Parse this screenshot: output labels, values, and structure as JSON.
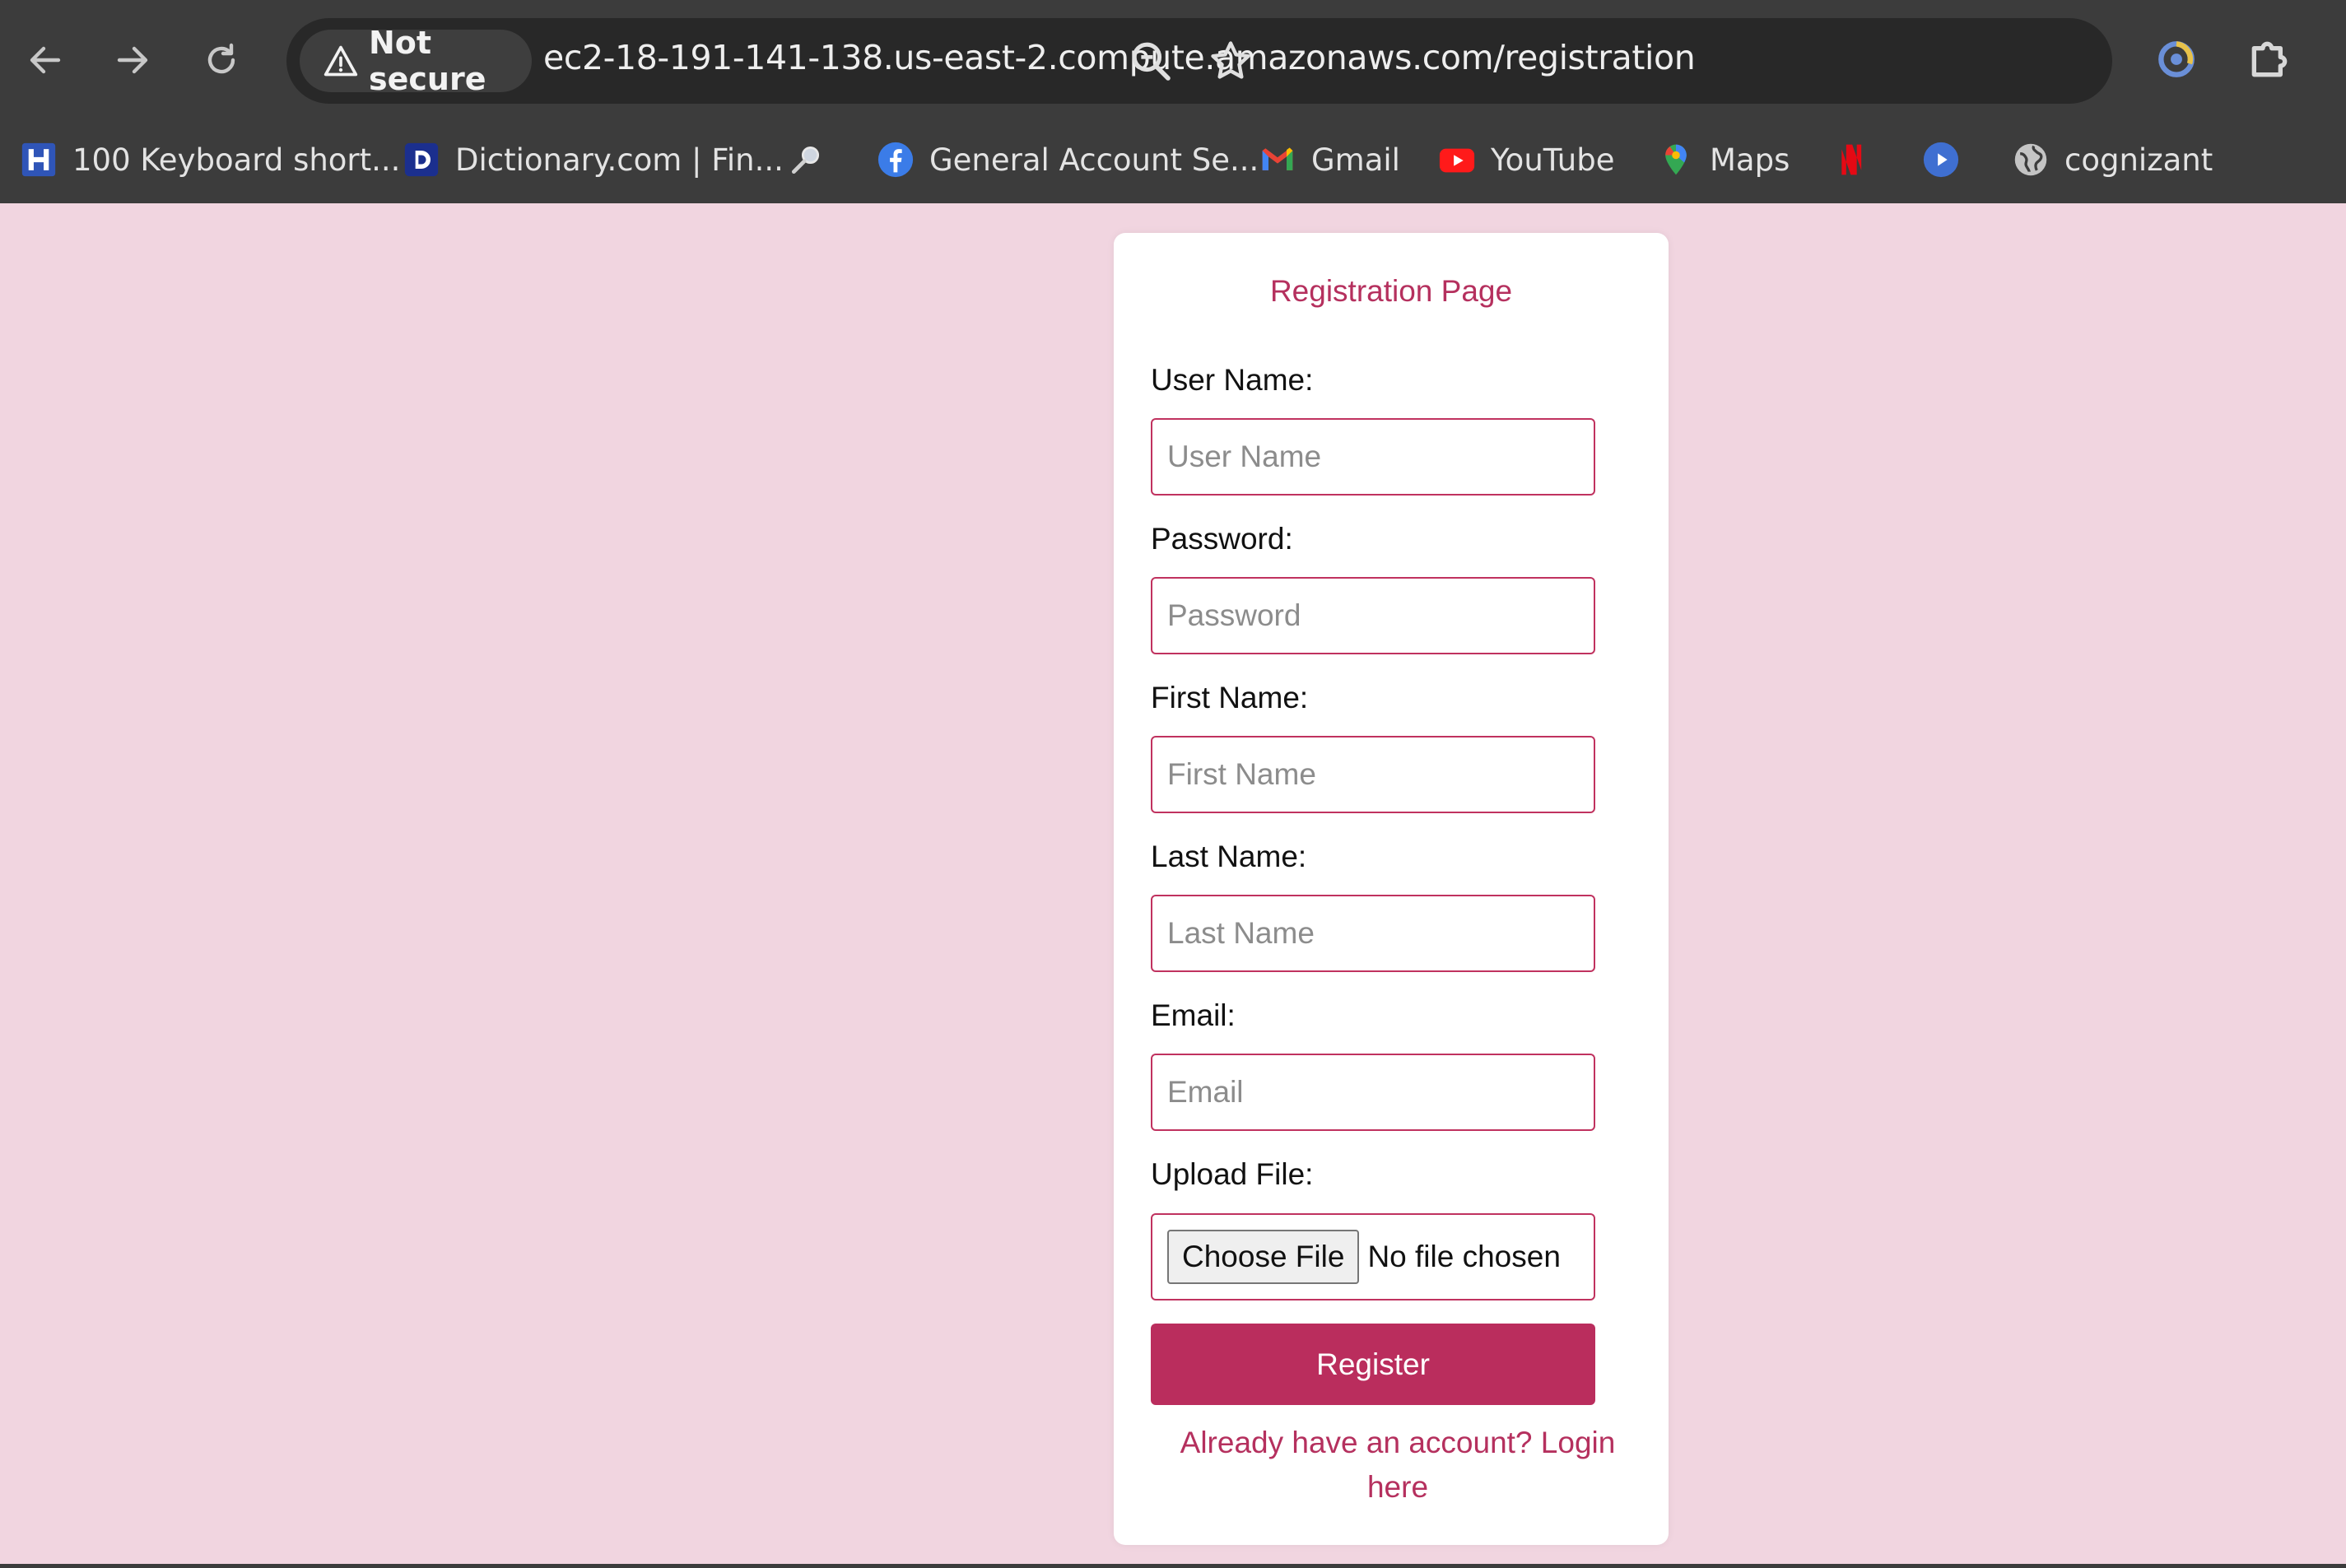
{
  "browser": {
    "security_label": "Not secure",
    "url": "ec2-18-191-141-138.us-east-2.compute.amazonaws.com/registration",
    "nav_icons": [
      "back-arrow-icon",
      "forward-arrow-icon",
      "reload-icon"
    ],
    "omnibox_icons": [
      "zoom-icon",
      "bookmark-star-icon"
    ],
    "toolbar_icons": [
      "extension-icon",
      "extensions-puzzle-icon"
    ],
    "bookmarks": [
      {
        "label": "100 Keyboard short...",
        "icon": "h-logo-icon"
      },
      {
        "label": "Dictionary.com | Fin...",
        "icon": "dictionary-logo-icon"
      },
      {
        "label": "",
        "icon": "magnifier-icon"
      },
      {
        "label": "General Account Se...",
        "icon": "facebook-icon"
      },
      {
        "label": "Gmail",
        "icon": "gmail-icon"
      },
      {
        "label": "YouTube",
        "icon": "youtube-icon"
      },
      {
        "label": "Maps",
        "icon": "maps-pin-icon"
      },
      {
        "label": "",
        "icon": "netflix-icon"
      },
      {
        "label": "",
        "icon": "play-circle-icon"
      },
      {
        "label": "cognizant",
        "icon": "globe-icon"
      }
    ]
  },
  "form": {
    "title": "Registration Page",
    "fields": [
      {
        "label": "User Name:",
        "placeholder": "User Name",
        "value": ""
      },
      {
        "label": "Password:",
        "placeholder": "Password",
        "value": ""
      },
      {
        "label": "First Name:",
        "placeholder": "First Name",
        "value": ""
      },
      {
        "label": "Last Name:",
        "placeholder": "Last Name",
        "value": ""
      },
      {
        "label": "Email:",
        "placeholder": "Email",
        "value": ""
      }
    ],
    "upload": {
      "label": "Upload File:",
      "button_label": "Choose File",
      "status": "No file chosen"
    },
    "submit_label": "Register",
    "login_link": "Already have an account? Login here"
  },
  "colors": {
    "page_background": "#f1d5e0",
    "accent": "#ba2d5d",
    "card_background": "#ffffff",
    "chrome_background": "#3c3c3c"
  }
}
